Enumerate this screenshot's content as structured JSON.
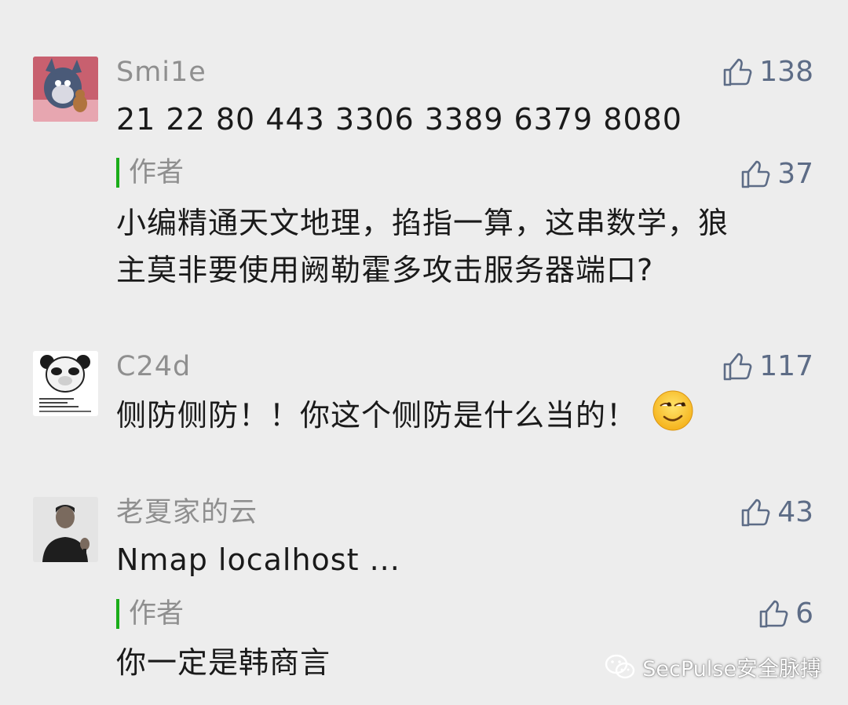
{
  "comments": [
    {
      "username": "Smi1e",
      "text": "21 22 80 443 3306 3389 6379 8080",
      "likes": "138",
      "reply": {
        "label": "作者",
        "likes": "37",
        "text_line1": "小编精通天文地理，掐指一算，这串数学，狼",
        "text_line2": "主莫非要使用阙勒霍多攻击服务器端口?"
      }
    },
    {
      "username": "C24d",
      "text": "侧防侧防！！你这个侧防是什么当的！",
      "likes": "117"
    },
    {
      "username": "老夏家的云",
      "text": "Nmap localhost ...",
      "likes": "43",
      "reply": {
        "label": "作者",
        "likes": "6",
        "text_line1": "你一定是韩商言"
      }
    }
  ],
  "watermark": "SecPulse安全脉搏",
  "colors": {
    "background": "#ededed",
    "username": "#8f8f8f",
    "text": "#1a1a1a",
    "like": "#5d6c86",
    "author_bar": "#1aad19"
  },
  "icons": {
    "like": "thumbs-up-icon",
    "emoji": "smirk-emoji-icon",
    "watermark": "wechat-icon"
  }
}
